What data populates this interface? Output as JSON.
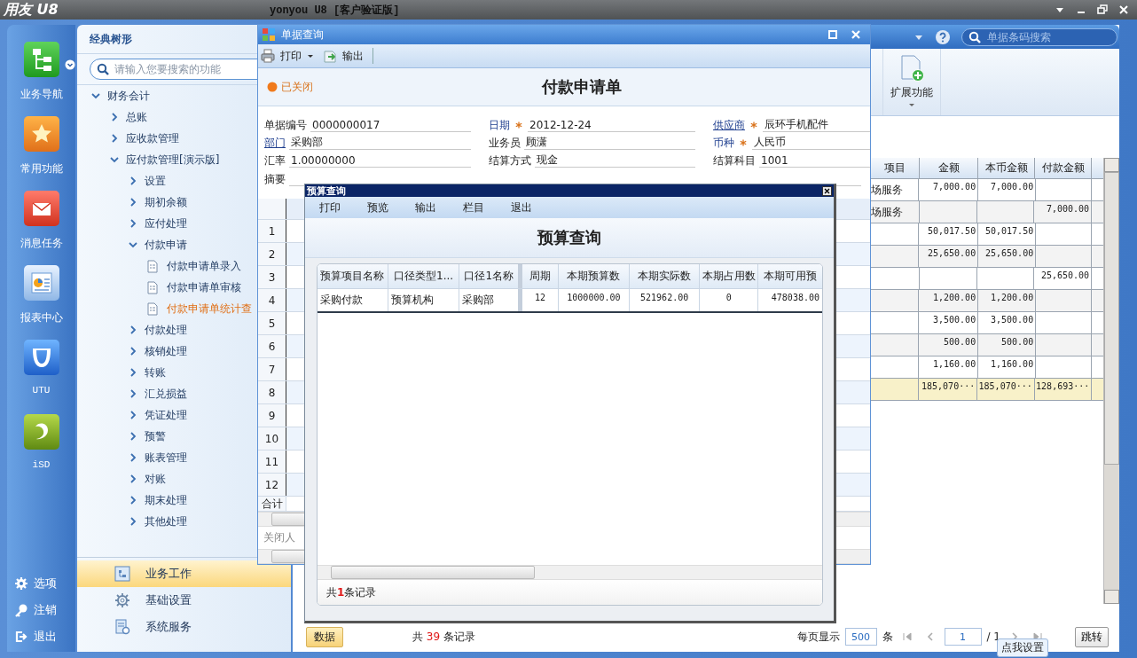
{
  "app": {
    "logo": "用友 U8",
    "title": "yonyou U8 [客户验证版]"
  },
  "rail": {
    "items": [
      {
        "label": "业务导航",
        "kind": "tree",
        "dropdown": true
      },
      {
        "label": "常用功能",
        "kind": "star",
        "dropdown": false
      },
      {
        "label": "消息任务",
        "kind": "mail",
        "dropdown": false
      },
      {
        "label": "报表中心",
        "kind": "report",
        "dropdown": false
      },
      {
        "label": "UTU",
        "kind": "utu",
        "dropdown": false
      },
      {
        "label": "iSD",
        "kind": "isd",
        "dropdown": false
      }
    ],
    "bottom": [
      {
        "label": "选项",
        "kind": "gear"
      },
      {
        "label": "注销",
        "kind": "key"
      },
      {
        "label": "退出",
        "kind": "exit"
      }
    ]
  },
  "nav": {
    "title": "经典树形",
    "search": {
      "placeholder": "请输入您要搜索的功能"
    },
    "tree": [
      {
        "label": "财务会计",
        "kind": "folder",
        "expanded": true,
        "children": [
          {
            "label": "总账",
            "kind": "folder",
            "expanded": false
          },
          {
            "label": "应收款管理",
            "kind": "folder",
            "expanded": false
          },
          {
            "label": "应付款管理[演示版]",
            "kind": "folder",
            "expanded": true,
            "children": [
              {
                "label": "设置",
                "kind": "folder",
                "expanded": false
              },
              {
                "label": "期初余额",
                "kind": "folder",
                "expanded": false
              },
              {
                "label": "应付处理",
                "kind": "folder",
                "expanded": false
              },
              {
                "label": "付款申请",
                "kind": "folder",
                "expanded": true,
                "children": [
                  {
                    "label": "付款申请单录入",
                    "kind": "doc",
                    "selected": false
                  },
                  {
                    "label": "付款申请单审核",
                    "kind": "doc",
                    "selected": false
                  },
                  {
                    "label": "付款申请单统计查",
                    "kind": "doc",
                    "selected": true
                  }
                ]
              },
              {
                "label": "付款处理",
                "kind": "folder",
                "expanded": false
              },
              {
                "label": "核销处理",
                "kind": "folder",
                "expanded": false
              },
              {
                "label": "转账",
                "kind": "folder",
                "expanded": false
              },
              {
                "label": "汇兑损益",
                "kind": "folder",
                "expanded": false
              },
              {
                "label": "凭证处理",
                "kind": "folder",
                "expanded": false
              },
              {
                "label": "预警",
                "kind": "folder",
                "expanded": false
              },
              {
                "label": "账表管理",
                "kind": "folder",
                "expanded": false
              },
              {
                "label": "对账",
                "kind": "folder",
                "expanded": false
              },
              {
                "label": "期末处理",
                "kind": "folder",
                "expanded": false
              },
              {
                "label": "其他处理",
                "kind": "folder",
                "expanded": false
              }
            ]
          }
        ]
      }
    ],
    "sections": [
      {
        "label": "业务工作",
        "kind": "work",
        "selected": true
      },
      {
        "label": "基础设置",
        "kind": "settings",
        "selected": false
      },
      {
        "label": "系统服务",
        "kind": "service",
        "selected": false
      }
    ]
  },
  "main": {
    "search": {
      "placeholder": "单据条码搜索"
    },
    "tools": [
      {
        "label": "扩展功能"
      }
    ],
    "table": {
      "columns": [
        "项目",
        "金额",
        "本币金额",
        "付款金额"
      ],
      "rows": [
        {
          "item": "场服务",
          "amount": "7,000.00",
          "base_amount": "7,000.00"
        },
        {
          "item": "场服务",
          "payment": "7,000.00"
        },
        {
          "amount": "50,017.50",
          "base_amount": "50,017.50"
        },
        {
          "amount": "25,650.00",
          "base_amount": "25,650.00"
        },
        {
          "payment": "25,650.00"
        },
        {
          "amount": "1,200.00",
          "base_amount": "1,200.00"
        },
        {
          "amount": "3,500.00",
          "base_amount": "3,500.00"
        },
        {
          "amount": "500.00",
          "base_amount": "500.00"
        },
        {
          "amount": "1,160.00",
          "base_amount": "1,160.00"
        }
      ],
      "total": {
        "amount": "185,070···",
        "base_amount": "185,070···",
        "payment": "128,693···"
      }
    },
    "footer": {
      "tab": "数据",
      "count_prefix": "共",
      "count": "39",
      "count_suffix": "条记录",
      "per_page_label": "每页显示",
      "per_page": "500",
      "per_page_unit": "条",
      "page": "1",
      "pages": "/ 1",
      "jump": "跳转"
    },
    "tooltip": "点我设置"
  },
  "voucher": {
    "title": "单据查询",
    "toolbar": [
      {
        "label": "打印",
        "kind": "print"
      },
      {
        "label": "输出",
        "kind": "export"
      }
    ],
    "status": "已关闭",
    "heading": "付款申请单",
    "fields": [
      {
        "label": "单据编号",
        "value": "0000000017",
        "kind": "plain",
        "required": false
      },
      {
        "label": "日期",
        "value": "2012-12-24",
        "kind": "blue",
        "required": true
      },
      {
        "label": "供应商",
        "value": "辰环手机配件",
        "kind": "link",
        "required": true
      },
      {
        "label": "部门",
        "value": "采购部",
        "kind": "link",
        "required": false
      },
      {
        "label": "业务员",
        "value": "顾潇",
        "kind": "plain",
        "required": false
      },
      {
        "label": "币种",
        "value": "人民币",
        "kind": "blue",
        "required": true
      },
      {
        "label": "汇率",
        "value": "1.00000000",
        "kind": "plain",
        "required": false
      },
      {
        "label": "结算方式",
        "value": "现金",
        "kind": "plain",
        "required": false
      },
      {
        "label": "结算科目",
        "value": "1001",
        "kind": "plain",
        "required": false
      }
    ],
    "summary_label": "摘要",
    "grid": {
      "rows": [
        "1",
        "2",
        "3",
        "4",
        "5",
        "6",
        "7",
        "8",
        "9",
        "10",
        "11",
        "12"
      ],
      "total": "合计"
    },
    "closer_label": "关闭人"
  },
  "budget": {
    "title": "预算查询",
    "menu": [
      "打印",
      "预览",
      "输出",
      "栏目",
      "退出"
    ],
    "heading": "预算查询",
    "table": {
      "columns": [
        "预算项目名称",
        "口径类型1...",
        "口径1名称",
        "周期",
        "本期预算数",
        "本期实际数",
        "本期占用数",
        "本期可用预"
      ],
      "rows": [
        [
          "采购付款",
          "预算机构",
          "采购部",
          "12",
          "1000000.00",
          "521962.00",
          "0",
          "478038.00"
        ]
      ]
    },
    "footer": {
      "prefix": "共",
      "count": "1",
      "suffix": "条记录"
    }
  }
}
